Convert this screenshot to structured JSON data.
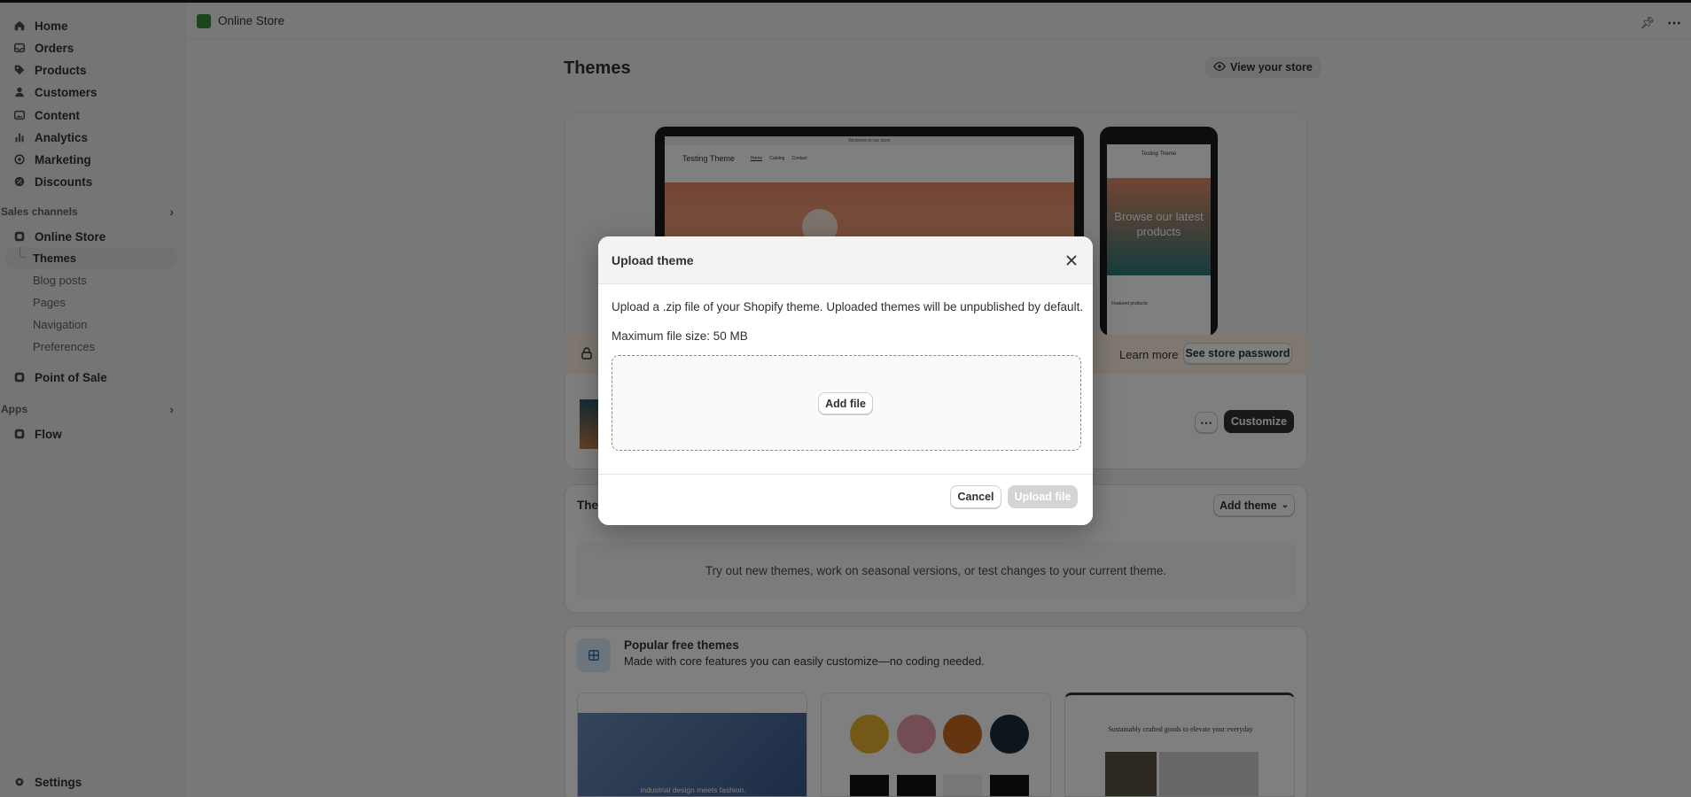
{
  "sidebar": {
    "main_items": [
      {
        "label": "Home",
        "icon": "home-icon"
      },
      {
        "label": "Orders",
        "icon": "inbox-icon"
      },
      {
        "label": "Products",
        "icon": "tag-icon"
      },
      {
        "label": "Customers",
        "icon": "person-icon"
      },
      {
        "label": "Content",
        "icon": "image-icon"
      },
      {
        "label": "Analytics",
        "icon": "bar-chart-icon"
      },
      {
        "label": "Marketing",
        "icon": "target-icon"
      },
      {
        "label": "Discounts",
        "icon": "gear-discount-icon"
      }
    ],
    "sales_channels_label": "Sales channels",
    "online_store_label": "Online Store",
    "sub_items": [
      "Themes",
      "Blog posts",
      "Pages",
      "Navigation",
      "Preferences"
    ],
    "point_of_sale_label": "Point of Sale",
    "apps_label": "Apps",
    "flow_label": "Flow",
    "settings_label": "Settings"
  },
  "topbar": {
    "title": "Online Store"
  },
  "main": {
    "page_title": "Themes",
    "view_store_label": "View your store",
    "preview": {
      "announcement": "Welcome to our store",
      "store_name": "Testing Theme",
      "nav_links": [
        "Home",
        "Catalog",
        "Contact"
      ],
      "mobile_store_name": "Testing Theme",
      "mobile_hero_text": "Browse our latest products",
      "mobile_section": "Featured products"
    },
    "banner": {
      "learn_more": "Learn more",
      "see_password": "See store password"
    },
    "customize_label": "Customize",
    "theme_library_title": "The",
    "add_theme_label": "Add theme",
    "empty_text": "Try out new themes, work on seasonal versions, or test changes to your current theme.",
    "popular": {
      "title": "Popular free themes",
      "subtitle": "Made with core features you can easily customize—no coding needed.",
      "thumb1_text": "industrial design meets fashion.",
      "thumb3_text": "Sustainably crafted goods to elevate your everyday"
    }
  },
  "modal": {
    "title": "Upload theme",
    "description": "Upload a .zip file of your Shopify theme. Uploaded themes will be unpublished by default.",
    "max_size": "Maximum file size: 50 MB",
    "add_file_label": "Add file",
    "cancel_label": "Cancel",
    "upload_label": "Upload file"
  },
  "colors": {
    "accent_dark": "#303030",
    "overlay": "rgba(0,0,0,0.5)",
    "banner": "#fdf0e0"
  }
}
